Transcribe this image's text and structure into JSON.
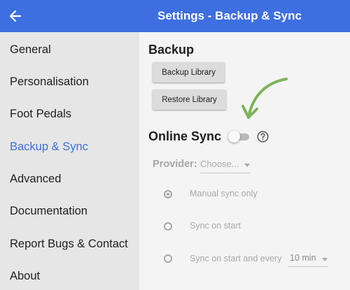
{
  "appbar": {
    "title": "Settings - Backup & Sync",
    "back_icon": "arrow-left-icon",
    "color": "#3d6fe0"
  },
  "sidebar": {
    "items": [
      {
        "label": "General",
        "active": false
      },
      {
        "label": "Personalisation",
        "active": false
      },
      {
        "label": "Foot Pedals",
        "active": false
      },
      {
        "label": "Backup & Sync",
        "active": true
      },
      {
        "label": "Advanced",
        "active": false
      },
      {
        "label": "Documentation",
        "active": false
      },
      {
        "label": "Report Bugs & Contact",
        "active": false
      },
      {
        "label": "About",
        "active": false
      }
    ]
  },
  "backup": {
    "heading": "Backup",
    "backup_button": "Backup Library",
    "restore_button": "Restore Library"
  },
  "sync": {
    "heading": "Online Sync",
    "enabled": false,
    "help_icon": "help-circle-icon",
    "provider_label": "Provider:",
    "provider_value": "Choose...",
    "options": [
      {
        "label": "Manual sync only",
        "selected": true
      },
      {
        "label": "Sync on start",
        "selected": false
      },
      {
        "label": "Sync on start and every",
        "selected": false
      }
    ],
    "interval_value": "10 min"
  },
  "annotation": {
    "icon": "green-curved-arrow-icon",
    "color": "#7db35a"
  }
}
